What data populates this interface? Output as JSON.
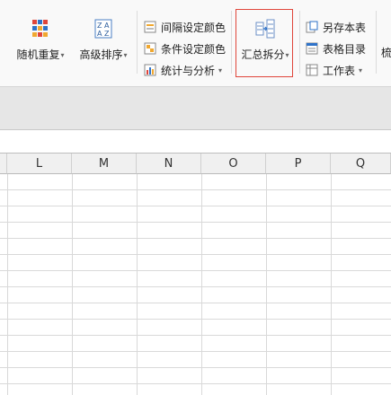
{
  "toolbar": {
    "random_repeat": "随机重复",
    "advanced_sort": "高级排序",
    "interval_color": "间隔设定颜色",
    "condition_color": "条件设定颜色",
    "stats_analysis": "统计与分析",
    "summary_split": "汇总拆分",
    "save_copy": "另存本表",
    "sheet_index": "表格目录",
    "worksheet": "工作表",
    "partial_next": "梳"
  },
  "columns": [
    "L",
    "M",
    "N",
    "O",
    "P",
    "Q"
  ],
  "colors": {
    "highlight": "#e0453a",
    "ribbon_bg": "#f9f9f9",
    "band": "#e6e6e6"
  }
}
